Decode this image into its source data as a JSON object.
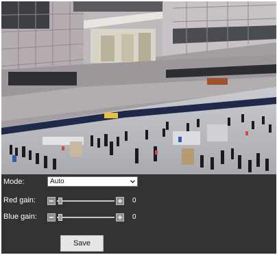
{
  "camera": {
    "description_icon": "camera-live-view"
  },
  "controls": {
    "mode": {
      "label": "Mode:",
      "value": "Auto"
    },
    "red_gain": {
      "label": "Red gain:",
      "value": "0",
      "level": 0
    },
    "blue_gain": {
      "label": "Blue gain:",
      "value": "0",
      "level": 0
    }
  },
  "save_label": "Save",
  "colors": {
    "panel_background": "#333333",
    "text": "#ffffff",
    "button_background": "#e6e6e6"
  }
}
